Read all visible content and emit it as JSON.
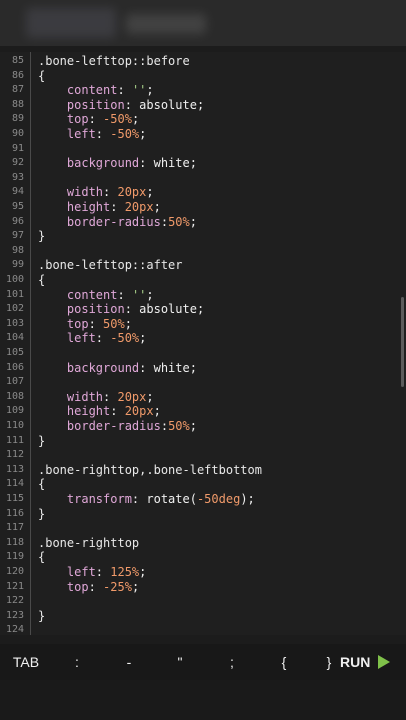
{
  "editor": {
    "lines": [
      {
        "n": "85",
        "tokens": [
          {
            "t": ".bone-lefttop::before",
            "c": "sel"
          }
        ]
      },
      {
        "n": "86",
        "tokens": [
          {
            "t": "{",
            "c": "brace"
          }
        ]
      },
      {
        "n": "87",
        "tokens": [
          {
            "t": "    content",
            "c": "prop"
          },
          {
            "t": ": ",
            "c": "val"
          },
          {
            "t": "''",
            "c": "str"
          },
          {
            "t": ";",
            "c": "val"
          }
        ]
      },
      {
        "n": "88",
        "tokens": [
          {
            "t": "    position",
            "c": "prop"
          },
          {
            "t": ": absolute;",
            "c": "val"
          }
        ]
      },
      {
        "n": "89",
        "tokens": [
          {
            "t": "    top",
            "c": "prop"
          },
          {
            "t": ": ",
            "c": "val"
          },
          {
            "t": "-50%",
            "c": "num"
          },
          {
            "t": ";",
            "c": "val"
          }
        ]
      },
      {
        "n": "90",
        "tokens": [
          {
            "t": "    left",
            "c": "prop"
          },
          {
            "t": ": ",
            "c": "val"
          },
          {
            "t": "-50%",
            "c": "num"
          },
          {
            "t": ";",
            "c": "val"
          }
        ]
      },
      {
        "n": "91",
        "tokens": []
      },
      {
        "n": "92",
        "tokens": [
          {
            "t": "    background",
            "c": "prop"
          },
          {
            "t": ": white;",
            "c": "val"
          }
        ]
      },
      {
        "n": "93",
        "tokens": []
      },
      {
        "n": "94",
        "tokens": [
          {
            "t": "    width",
            "c": "prop"
          },
          {
            "t": ": ",
            "c": "val"
          },
          {
            "t": "20px",
            "c": "num"
          },
          {
            "t": ";",
            "c": "val"
          }
        ]
      },
      {
        "n": "95",
        "tokens": [
          {
            "t": "    height",
            "c": "prop"
          },
          {
            "t": ": ",
            "c": "val"
          },
          {
            "t": "20px",
            "c": "num"
          },
          {
            "t": ";",
            "c": "val"
          }
        ]
      },
      {
        "n": "96",
        "tokens": [
          {
            "t": "    border-radius",
            "c": "prop"
          },
          {
            "t": ":",
            "c": "val"
          },
          {
            "t": "50%",
            "c": "num"
          },
          {
            "t": ";",
            "c": "val"
          }
        ]
      },
      {
        "n": "97",
        "tokens": [
          {
            "t": "}",
            "c": "brace"
          }
        ]
      },
      {
        "n": "98",
        "tokens": []
      },
      {
        "n": "99",
        "tokens": [
          {
            "t": ".bone-lefttop::after",
            "c": "sel"
          }
        ]
      },
      {
        "n": "100",
        "tokens": [
          {
            "t": "{",
            "c": "brace"
          }
        ]
      },
      {
        "n": "101",
        "tokens": [
          {
            "t": "    content",
            "c": "prop"
          },
          {
            "t": ": ",
            "c": "val"
          },
          {
            "t": "''",
            "c": "str"
          },
          {
            "t": ";",
            "c": "val"
          }
        ]
      },
      {
        "n": "102",
        "tokens": [
          {
            "t": "    position",
            "c": "prop"
          },
          {
            "t": ": absolute;",
            "c": "val"
          }
        ]
      },
      {
        "n": "103",
        "tokens": [
          {
            "t": "    top",
            "c": "prop"
          },
          {
            "t": ": ",
            "c": "val"
          },
          {
            "t": "50%",
            "c": "num"
          },
          {
            "t": ";",
            "c": "val"
          }
        ]
      },
      {
        "n": "104",
        "tokens": [
          {
            "t": "    left",
            "c": "prop"
          },
          {
            "t": ": ",
            "c": "val"
          },
          {
            "t": "-50%",
            "c": "num"
          },
          {
            "t": ";",
            "c": "val"
          }
        ]
      },
      {
        "n": "105",
        "tokens": []
      },
      {
        "n": "106",
        "tokens": [
          {
            "t": "    background",
            "c": "prop"
          },
          {
            "t": ": white;",
            "c": "val"
          }
        ]
      },
      {
        "n": "107",
        "tokens": []
      },
      {
        "n": "108",
        "tokens": [
          {
            "t": "    width",
            "c": "prop"
          },
          {
            "t": ": ",
            "c": "val"
          },
          {
            "t": "20px",
            "c": "num"
          },
          {
            "t": ";",
            "c": "val"
          }
        ]
      },
      {
        "n": "109",
        "tokens": [
          {
            "t": "    height",
            "c": "prop"
          },
          {
            "t": ": ",
            "c": "val"
          },
          {
            "t": "20px",
            "c": "num"
          },
          {
            "t": ";",
            "c": "val"
          }
        ]
      },
      {
        "n": "110",
        "tokens": [
          {
            "t": "    border-radius",
            "c": "prop"
          },
          {
            "t": ":",
            "c": "val"
          },
          {
            "t": "50%",
            "c": "num"
          },
          {
            "t": ";",
            "c": "val"
          }
        ]
      },
      {
        "n": "111",
        "tokens": [
          {
            "t": "}",
            "c": "brace"
          }
        ]
      },
      {
        "n": "112",
        "tokens": []
      },
      {
        "n": "113",
        "tokens": [
          {
            "t": ".bone-righttop,.bone-leftbottom",
            "c": "sel"
          }
        ]
      },
      {
        "n": "114",
        "tokens": [
          {
            "t": "{",
            "c": "brace"
          }
        ]
      },
      {
        "n": "115",
        "tokens": [
          {
            "t": "    transform",
            "c": "prop"
          },
          {
            "t": ": rotate(",
            "c": "val"
          },
          {
            "t": "-50deg",
            "c": "num"
          },
          {
            "t": ");",
            "c": "val"
          }
        ]
      },
      {
        "n": "116",
        "tokens": [
          {
            "t": "}",
            "c": "brace"
          }
        ]
      },
      {
        "n": "117",
        "tokens": []
      },
      {
        "n": "118",
        "tokens": [
          {
            "t": ".bone-righttop",
            "c": "sel"
          }
        ]
      },
      {
        "n": "119",
        "tokens": [
          {
            "t": "{",
            "c": "brace"
          }
        ]
      },
      {
        "n": "120",
        "tokens": [
          {
            "t": "    left",
            "c": "prop"
          },
          {
            "t": ": ",
            "c": "val"
          },
          {
            "t": "125%",
            "c": "num"
          },
          {
            "t": ";",
            "c": "val"
          }
        ]
      },
      {
        "n": "121",
        "tokens": [
          {
            "t": "    top",
            "c": "prop"
          },
          {
            "t": ": ",
            "c": "val"
          },
          {
            "t": "-25%",
            "c": "num"
          },
          {
            "t": ";",
            "c": "val"
          }
        ]
      },
      {
        "n": "122",
        "tokens": []
      },
      {
        "n": "123",
        "tokens": [
          {
            "t": "}",
            "c": "brace"
          }
        ]
      },
      {
        "n": "124",
        "tokens": []
      }
    ]
  },
  "keybar": {
    "keys": [
      "TAB",
      ":",
      "-",
      "\"",
      ";",
      "{",
      "}"
    ],
    "run_label": "RUN",
    "run_icon": "play-icon",
    "run_color": "#7fc14a"
  },
  "theme": {
    "selector": "#e8e8e8",
    "property": "#e0a8d8",
    "number": "#f09a6a",
    "string": "#a8d08a",
    "line_number": "#8a8a8a"
  }
}
